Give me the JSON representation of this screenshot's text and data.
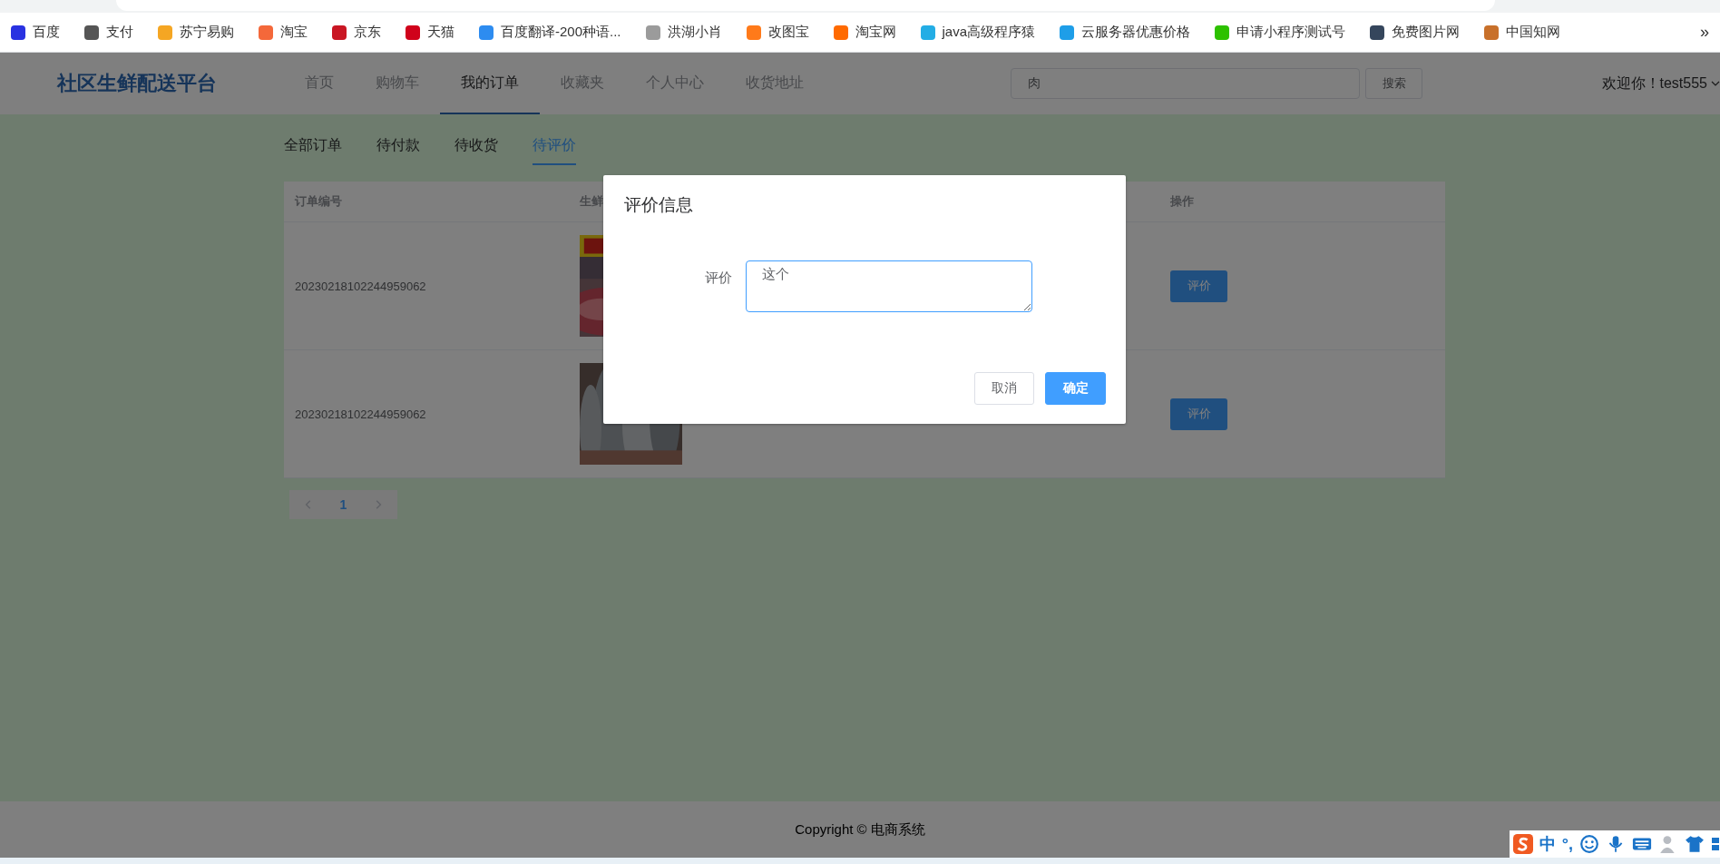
{
  "browser": {
    "bookmarks": [
      {
        "label": "百度",
        "color": "#2932e1"
      },
      {
        "label": "支付",
        "color": "#555555"
      },
      {
        "label": "苏宁易购",
        "color": "#f5a623"
      },
      {
        "label": "淘宝",
        "color": "#f4683a"
      },
      {
        "label": "京东",
        "color": "#c91623"
      },
      {
        "label": "天猫",
        "color": "#d0021b"
      },
      {
        "label": "百度翻译-200种语...",
        "color": "#2d8cf0"
      },
      {
        "label": "洪湖小肖",
        "color": "#9b9b9b"
      },
      {
        "label": "改图宝",
        "color": "#ff7a1a"
      },
      {
        "label": "淘宝网",
        "color": "#ff6a00"
      },
      {
        "label": "java高级程序猿",
        "color": "#23ade5"
      },
      {
        "label": "云服务器优惠价格",
        "color": "#1e9ee8"
      },
      {
        "label": "申请小程序测试号",
        "color": "#2dc100"
      },
      {
        "label": "免费图片网",
        "color": "#35465c"
      },
      {
        "label": "中国知网",
        "color": "#c8702a"
      }
    ],
    "more": "»"
  },
  "header": {
    "logo": "社区生鲜配送平台",
    "nav": [
      {
        "label": "首页",
        "selected": false
      },
      {
        "label": "购物车",
        "selected": false
      },
      {
        "label": "我的订单",
        "selected": true
      },
      {
        "label": "收藏夹",
        "selected": false
      },
      {
        "label": "个人中心",
        "selected": false
      },
      {
        "label": "收货地址",
        "selected": false
      }
    ],
    "search": {
      "value": "肉",
      "button": "搜索"
    },
    "user": "欢迎你！test555"
  },
  "tabs": [
    {
      "label": "全部订单",
      "selected": false
    },
    {
      "label": "待付款",
      "selected": false
    },
    {
      "label": "待收货",
      "selected": false
    },
    {
      "label": "待评价",
      "selected": true
    }
  ],
  "table": {
    "columns": [
      "订单编号",
      "生鲜",
      "操作"
    ],
    "rows": [
      {
        "order_no": "20230218102244959062",
        "action": "评价"
      },
      {
        "order_no": "20230218102244959062",
        "action": "评价"
      }
    ]
  },
  "pagination": {
    "pages": [
      {
        "label": "1",
        "selected": true
      }
    ]
  },
  "dialog": {
    "title": "评价信息",
    "label": "评价",
    "value": "这个",
    "buttons": [
      {
        "label": "取消",
        "kind": "default"
      },
      {
        "label": "确定",
        "kind": "primary"
      }
    ]
  },
  "footer": "Copyright © 电商系统",
  "ime": {
    "items": [
      "中",
      "°,"
    ]
  }
}
